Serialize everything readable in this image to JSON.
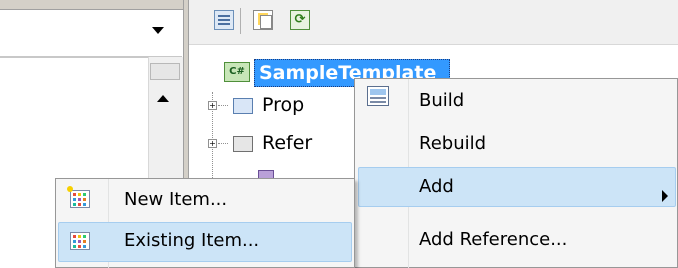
{
  "solution_explorer": {
    "toolbar": {
      "buttons": [
        {
          "icon": "properties-icon"
        },
        {
          "icon": "show-all-files-icon"
        },
        {
          "icon": "refresh-icon"
        }
      ]
    },
    "tree": {
      "root": {
        "label": "SampleTemplate",
        "icon": "csharp-project-icon"
      },
      "children": [
        {
          "label": "Prop",
          "icon": "properties-folder-icon"
        },
        {
          "label": "Refer",
          "icon": "references-folder-icon"
        }
      ]
    }
  },
  "context_menu": {
    "items": [
      {
        "label": "Build",
        "icon": "build-icon"
      },
      {
        "label": "Rebuild"
      },
      {
        "label": "Add",
        "has_submenu": true,
        "highlighted": true
      },
      {
        "label": "Add Reference..."
      }
    ]
  },
  "add_submenu": {
    "items": [
      {
        "label": "New Item...",
        "icon": "new-item-icon"
      },
      {
        "label": "Existing Item...",
        "icon": "existing-item-icon",
        "highlighted": true
      }
    ]
  },
  "colors": {
    "selection_blue": "#3399ff",
    "menu_highlight": "#cce4f7",
    "menu_highlight_border": "#a6cdef",
    "menu_background": "#f5f5f5"
  }
}
